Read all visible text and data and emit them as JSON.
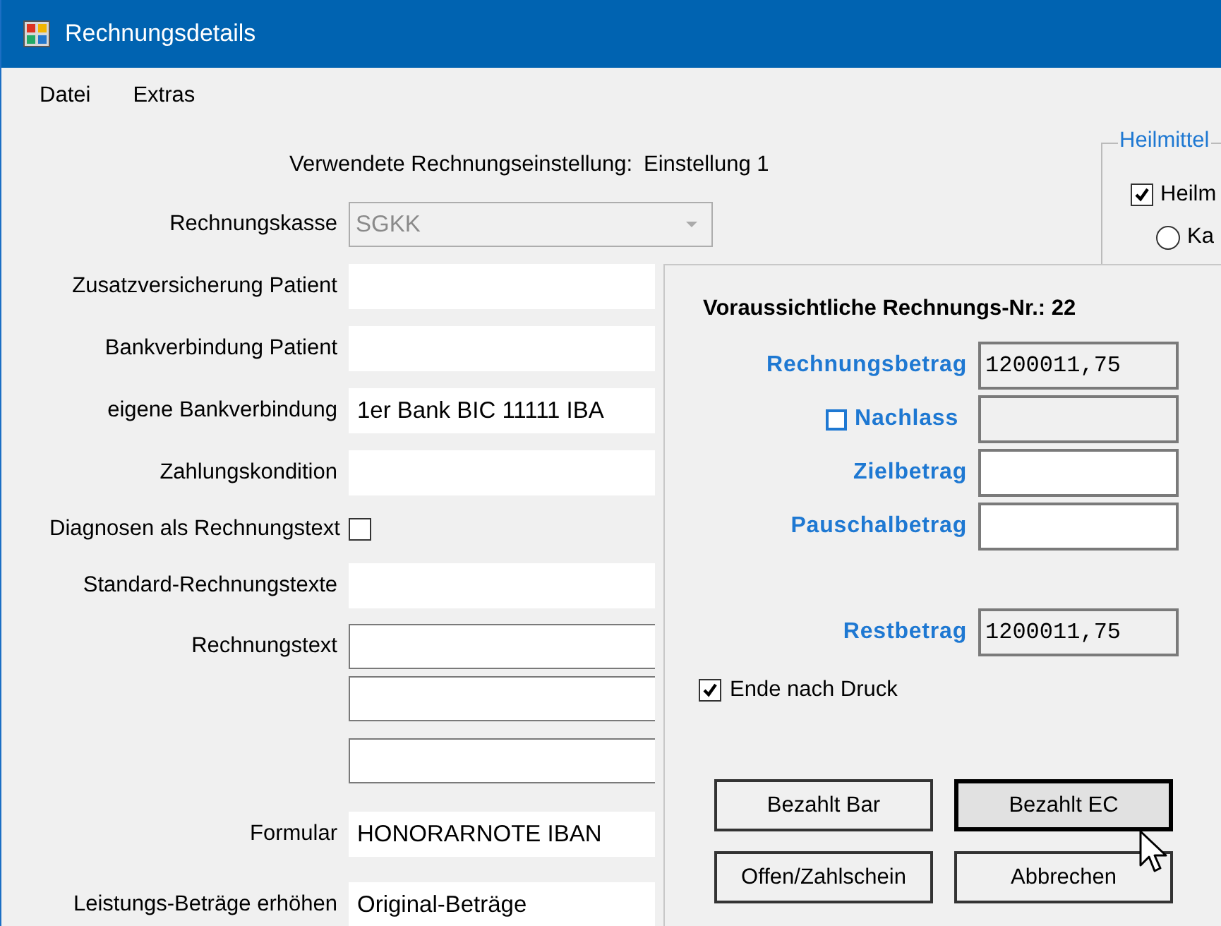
{
  "window": {
    "title": "Rechnungsdetails"
  },
  "menu": [
    "Datei",
    "Extras"
  ],
  "setting": {
    "label": "Verwendete Rechnungseinstellung:",
    "value": "Einstellung 1"
  },
  "form": [
    {
      "kind": "combo",
      "label": "Rechnungskasse",
      "value": "SGKK",
      "disabled": true
    },
    {
      "kind": "field",
      "label": "Zusatzversicherung Patient"
    },
    {
      "kind": "field",
      "label": "Bankverbindung Patient"
    },
    {
      "kind": "field",
      "label": "eigene Bankverbindung",
      "value": "1er Bank BIC 11111 IBA"
    },
    {
      "kind": "field",
      "label": "Zahlungskondition"
    },
    {
      "kind": "checkbox",
      "label": "Diagnosen als Rechnungstext",
      "checked": false
    },
    {
      "kind": "field",
      "label": "Standard-Rechnungstexte"
    },
    {
      "kind": "textlines",
      "label": "Rechnungstext"
    },
    {
      "kind": "field",
      "label": "Formular",
      "value": "HONORARNOTE IBAN"
    },
    {
      "kind": "field",
      "label": "Leistungs-Beträge erhöhen",
      "value": "Original-Beträge"
    }
  ],
  "heilmittel_group": {
    "title": "Heilmittel",
    "checkbox": {
      "label": "Heilm",
      "checked": true
    },
    "radio": {
      "label": "Ka",
      "selected": false
    }
  },
  "dialog": {
    "heading": "Voraussichtliche Rechnungs-Nr.: 22",
    "amounts": [
      {
        "kind": "readonly",
        "label": "Rechnungsbetrag",
        "value": "1200011,75"
      },
      {
        "kind": "checkfield",
        "label": "Nachlass",
        "checked": false
      },
      {
        "kind": "input",
        "label": "Zielbetrag"
      },
      {
        "kind": "input",
        "label": "Pauschalbetrag"
      }
    ],
    "rest": {
      "label": "Restbetrag",
      "value": "1200011,75"
    },
    "end_after_print": {
      "label": "Ende nach Druck",
      "checked": true
    },
    "buttons": [
      {
        "label": "Bezahlt Bar",
        "focused": false
      },
      {
        "label": "Bezahlt EC",
        "focused": true
      },
      {
        "label": "Offen/Zahlschein",
        "focused": false
      },
      {
        "label": "Abbrechen",
        "focused": false
      }
    ]
  }
}
